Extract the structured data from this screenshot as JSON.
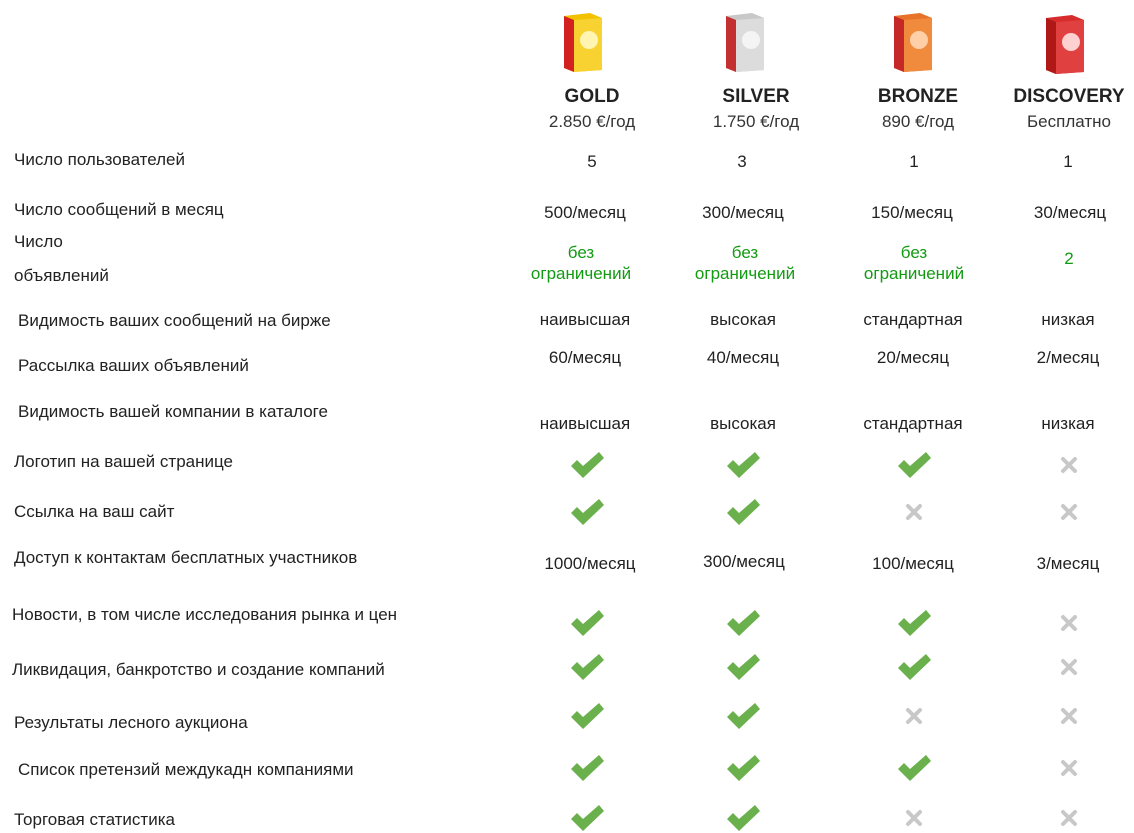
{
  "plans": [
    {
      "name": "GOLD",
      "price": "2.850 €/год",
      "color": "#f2c200"
    },
    {
      "name": "SILVER",
      "price": "1.750 €/год",
      "color": "#c8c8c8"
    },
    {
      "name": "BRONZE",
      "price": "890 €/год",
      "color": "#e8722a"
    },
    {
      "name": "DISCOVERY",
      "price": "Бесплатно",
      "color": "#d62c2c"
    }
  ],
  "features": [
    {
      "label": "Число пользователей",
      "values": [
        "5",
        "3",
        "1",
        "1"
      ]
    },
    {
      "label": "Число сообщений в месяц",
      "values": [
        "500/месяц",
        "300/месяц",
        "150/месяц",
        "30/месяц"
      ]
    },
    {
      "label_line1": "Число",
      "label_line2": "объявлений",
      "values": [
        "без ограничений",
        "без ограничений",
        "без ограничений",
        "2"
      ]
    },
    {
      "label": "Видимость ваших сообщений на бирже",
      "values": [
        "наивысшая",
        "высокая",
        "стандартная",
        "низкая"
      ]
    },
    {
      "label": "Рассылка ваших объявлений",
      "values": [
        "60/месяц",
        "40/месяц",
        "20/месяц",
        "2/месяц"
      ]
    },
    {
      "label": "Видимость вашей компании в каталоге",
      "values": [
        "наивысшая",
        "высокая",
        "стандартная",
        "низкая"
      ]
    },
    {
      "label": "Логотип на вашей странице",
      "values": [
        "check",
        "check",
        "check",
        "cross"
      ]
    },
    {
      "label": "Ссылка на ваш сайт",
      "values": [
        "check",
        "check",
        "cross",
        "cross"
      ]
    },
    {
      "label": "Доступ к контактам бесплатных участников",
      "values": [
        "1000/месяц",
        "300/месяц",
        "100/месяц",
        "3/месяц"
      ]
    },
    {
      "label": "Новости, в том числе исследования рынка и цен",
      "values": [
        "check",
        "check",
        "check",
        "cross"
      ]
    },
    {
      "label": "Ликвидация, банкротство и создание компаний",
      "values": [
        "check",
        "check",
        "check",
        "cross"
      ]
    },
    {
      "label": "Результаты лесного аукциона",
      "values": [
        "check",
        "check",
        "cross",
        "cross"
      ]
    },
    {
      "label": "Список претензий междукадн компаниями",
      "values": [
        "check",
        "check",
        "check",
        "cross"
      ]
    },
    {
      "label": "Торговая статистика",
      "values": [
        "check",
        "check",
        "cross",
        "cross"
      ]
    }
  ],
  "colors": {
    "check": "#6ab04c",
    "cross": "#c8c8c8",
    "unlimited": "#129a12"
  }
}
